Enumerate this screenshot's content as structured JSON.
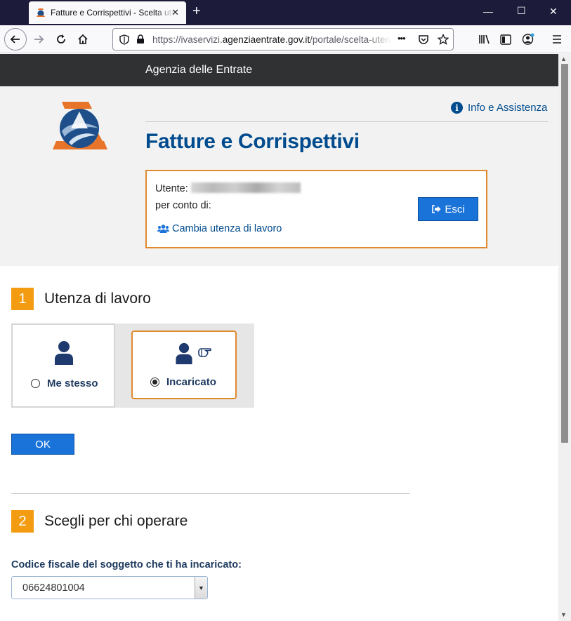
{
  "browser": {
    "tab_title": "Fatture e Corrispettivi - Scelta utenza di lavoro",
    "url_prefix": "https://ivaservizi.",
    "url_domain": "agenziaentrate.gov.it",
    "url_path": "/portale/scelta-utenza-lavoro",
    "menu_dots": "•••"
  },
  "site": {
    "agency_name": "Agenzia delle Entrate",
    "info_link": "Info e Assistenza",
    "app_title": "Fatture e Corrispettivi"
  },
  "user_box": {
    "user_label": "Utente:",
    "on_behalf_label": "per conto di:",
    "change_link": "Cambia utenza di lavoro",
    "logout_label": "Esci"
  },
  "step1": {
    "number": "1",
    "title": "Utenza di lavoro",
    "options": [
      {
        "label": "Me stesso",
        "selected": false
      },
      {
        "label": "Incaricato",
        "selected": true
      }
    ],
    "ok_label": "OK"
  },
  "step2": {
    "number": "2",
    "title": "Scegli per chi operare",
    "field_label": "Codice fiscale del soggetto che ti ha incaricato:",
    "selected_value": "06624801004"
  },
  "colors": {
    "brand_blue": "#004b8d",
    "accent_orange": "#e08a2e",
    "step_orange": "#f39c12",
    "button_blue": "#1a73d9"
  }
}
